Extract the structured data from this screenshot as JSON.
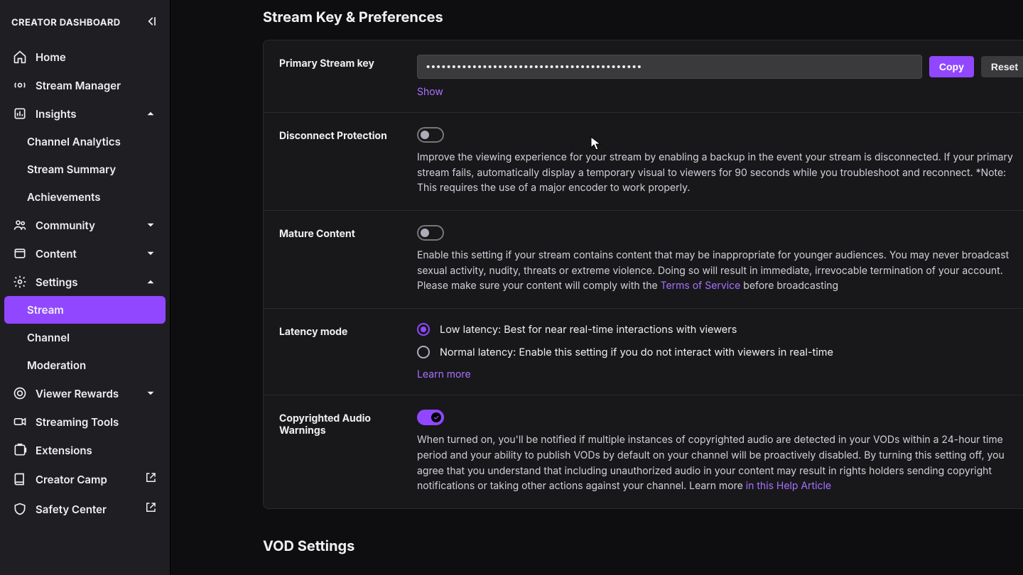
{
  "sidebar": {
    "title": "CREATOR DASHBOARD",
    "items": {
      "home": "Home",
      "stream_manager": "Stream Manager",
      "insights": "Insights",
      "channel_analytics": "Channel Analytics",
      "stream_summary": "Stream Summary",
      "achievements": "Achievements",
      "community": "Community",
      "content": "Content",
      "settings": "Settings",
      "stream": "Stream",
      "channel": "Channel",
      "moderation": "Moderation",
      "viewer_rewards": "Viewer Rewards",
      "streaming_tools": "Streaming Tools",
      "extensions": "Extensions",
      "creator_camp": "Creator Camp",
      "safety_center": "Safety Center"
    }
  },
  "main": {
    "section_title": "Stream Key & Preferences",
    "vod_title": "VOD Settings",
    "stream_key": {
      "label": "Primary Stream key",
      "masked": "••••••••••••••••••••••••••••••••••••••••••",
      "copy": "Copy",
      "reset": "Reset",
      "show": "Show"
    },
    "disconnect": {
      "label": "Disconnect Protection",
      "desc": "Improve the viewing experience for your stream by enabling a backup in the event your stream is disconnected. If your primary stream fails, automatically display a temporary visual to viewers for 90 seconds while you troubleshoot and reconnect. *Note: This requires the use of a major encoder to work properly."
    },
    "mature": {
      "label": "Mature Content",
      "desc_a": "Enable this setting if your stream contains content that may be inappropriate for younger audiences. You may never broadcast sexual activity, nudity, threats or extreme violence. Doing so will result in immediate, irrevocable termination of your account. Please make sure your content will comply with the ",
      "tos": "Terms of Service",
      "desc_b": " before broadcasting"
    },
    "latency": {
      "label": "Latency mode",
      "low": "Low latency: Best for near real-time interactions with viewers",
      "normal": "Normal latency: Enable this setting if you do not interact with viewers in real-time",
      "learn": "Learn more"
    },
    "audio": {
      "label": "Copyrighted Audio Warnings",
      "desc_a": "When turned on, you'll be notified if multiple instances of copyrighted audio are detected in your VODs within a 24-hour time period and your ability to publish VODs by default on your channel will be proactively disabled. By turning this setting off, you agree that you understand that including unauthorized audio in your content may result in rights holders sending copyright notifications or taking other actions against your channel. Learn more ",
      "help_link": "in this Help Article"
    }
  }
}
